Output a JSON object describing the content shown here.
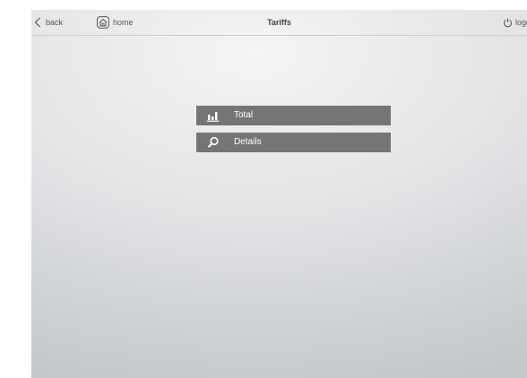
{
  "header": {
    "back_label": "back",
    "home_label": "home",
    "title": "Tariffs",
    "logout_label": "logout"
  },
  "menu": {
    "items": [
      {
        "label": "Total",
        "icon": "bar-chart-icon"
      },
      {
        "label": "Details",
        "icon": "magnifier-icon"
      }
    ]
  },
  "colors": {
    "menu_item_background": "#757575",
    "menu_item_text": "#ffffff",
    "header_text": "#555555"
  }
}
